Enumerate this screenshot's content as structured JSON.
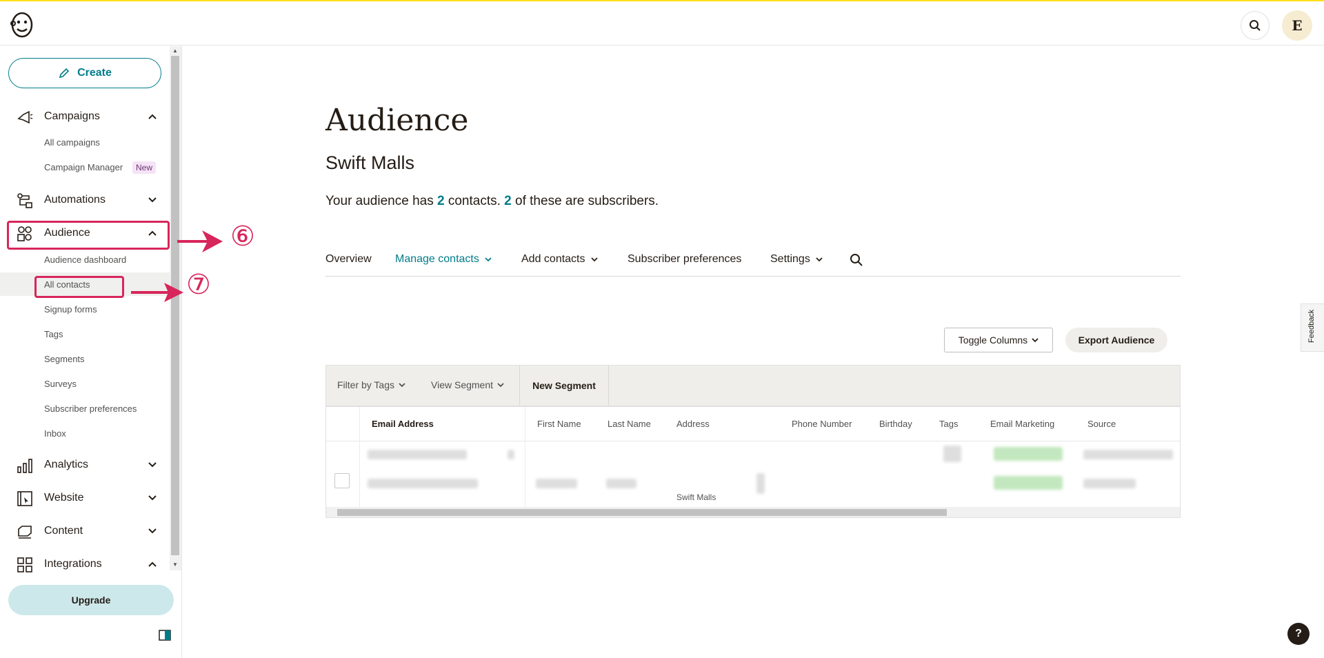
{
  "header": {
    "avatar_initial": "E"
  },
  "sidebar": {
    "create_label": "Create",
    "campaigns": {
      "label": "Campaigns",
      "items": [
        "All campaigns",
        "Campaign Manager"
      ],
      "new_badge": "New"
    },
    "automations": {
      "label": "Automations"
    },
    "audience": {
      "label": "Audience",
      "items": [
        "Audience dashboard",
        "All contacts",
        "Signup forms",
        "Tags",
        "Segments",
        "Surveys",
        "Subscriber preferences",
        "Inbox"
      ]
    },
    "analytics": {
      "label": "Analytics"
    },
    "website": {
      "label": "Website"
    },
    "content": {
      "label": "Content"
    },
    "integrations": {
      "label": "Integrations"
    },
    "upgrade_label": "Upgrade"
  },
  "annotations": {
    "step6": "⑥",
    "step7": "⑦",
    "color": "#d7265b"
  },
  "main": {
    "title": "Audience",
    "audience_name": "Swift Malls",
    "summary": {
      "prefix": "Your audience has ",
      "contacts": "2",
      "middle": " contacts. ",
      "subscribers": "2",
      "suffix": " of these are subscribers."
    },
    "tabs": [
      "Overview",
      "Manage contacts",
      "Add contacts",
      "Subscriber preferences",
      "Settings"
    ],
    "toggle_columns": "Toggle Columns",
    "export_audience": "Export Audience",
    "filters": {
      "filter_by_tags": "Filter by Tags",
      "view_segment": "View Segment",
      "new_segment": "New Segment"
    },
    "table": {
      "columns": [
        "Email Address",
        "First Name",
        "Last Name",
        "Address",
        "Phone Number",
        "Birthday",
        "Tags",
        "Email Marketing",
        "Source"
      ],
      "row2_address": "Swift Malls"
    }
  },
  "feedback_label": "Feedback",
  "help_label": "?",
  "colors": {
    "accent": "#007c89",
    "brand_yellow": "#ffe01b",
    "annotation": "#d7265b"
  }
}
